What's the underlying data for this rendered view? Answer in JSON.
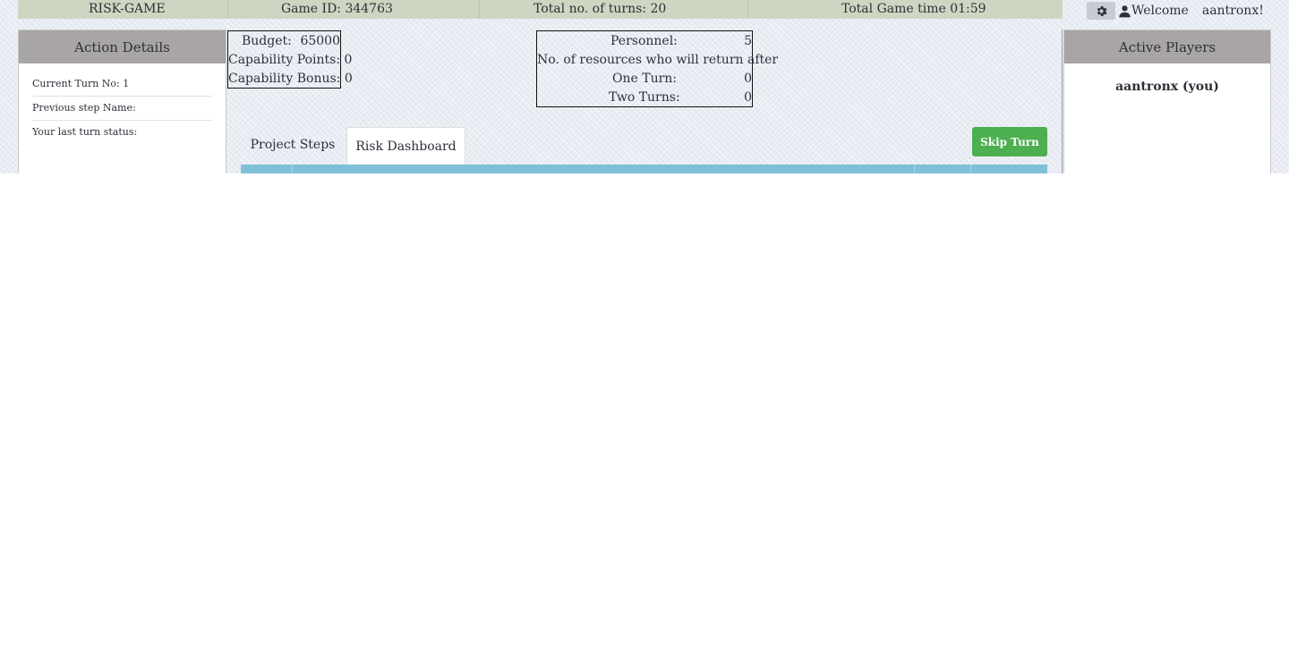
{
  "header": {
    "title": "RISK-GAME",
    "game_id": "Game ID: 344763",
    "total_turns": "Total no. of turns: 20",
    "game_time": "Total Game time 01:59"
  },
  "user": {
    "welcome": "Welcome",
    "name": "aantronx!"
  },
  "action_details": {
    "title": "Action Details",
    "current_turn": "Current Turn No: 1",
    "previous_step": "Previous step Name:",
    "last_status": "Your last turn status:"
  },
  "active_players": {
    "title": "Active Players",
    "players": [
      "aantronx (you)"
    ]
  },
  "budget_box": {
    "budget_label": "Budget:",
    "budget_value": "65000",
    "capability_points": "Capability Points: 0",
    "capability_bonus": "Capability Bonus: 0"
  },
  "personnel_box": {
    "personnel_label": "Personnel:",
    "personnel_value": "5",
    "return_label": "No. of resources who will return after",
    "one_turn_label": "One Turn:",
    "one_turn_value": "0",
    "two_turns_label": "Two Turns:",
    "two_turns_value": "0"
  },
  "tabs": [
    {
      "label": "Project Steps",
      "active": false
    },
    {
      "label": "Risk Dashboard",
      "active": true
    }
  ],
  "skip_button": "Skip Turn",
  "colors": {
    "header_bg": "#ced6c1",
    "panel_head_bg": "#a9a5a5",
    "skip_green": "#4caf50",
    "table_head_blue": "#7fbfd8"
  }
}
